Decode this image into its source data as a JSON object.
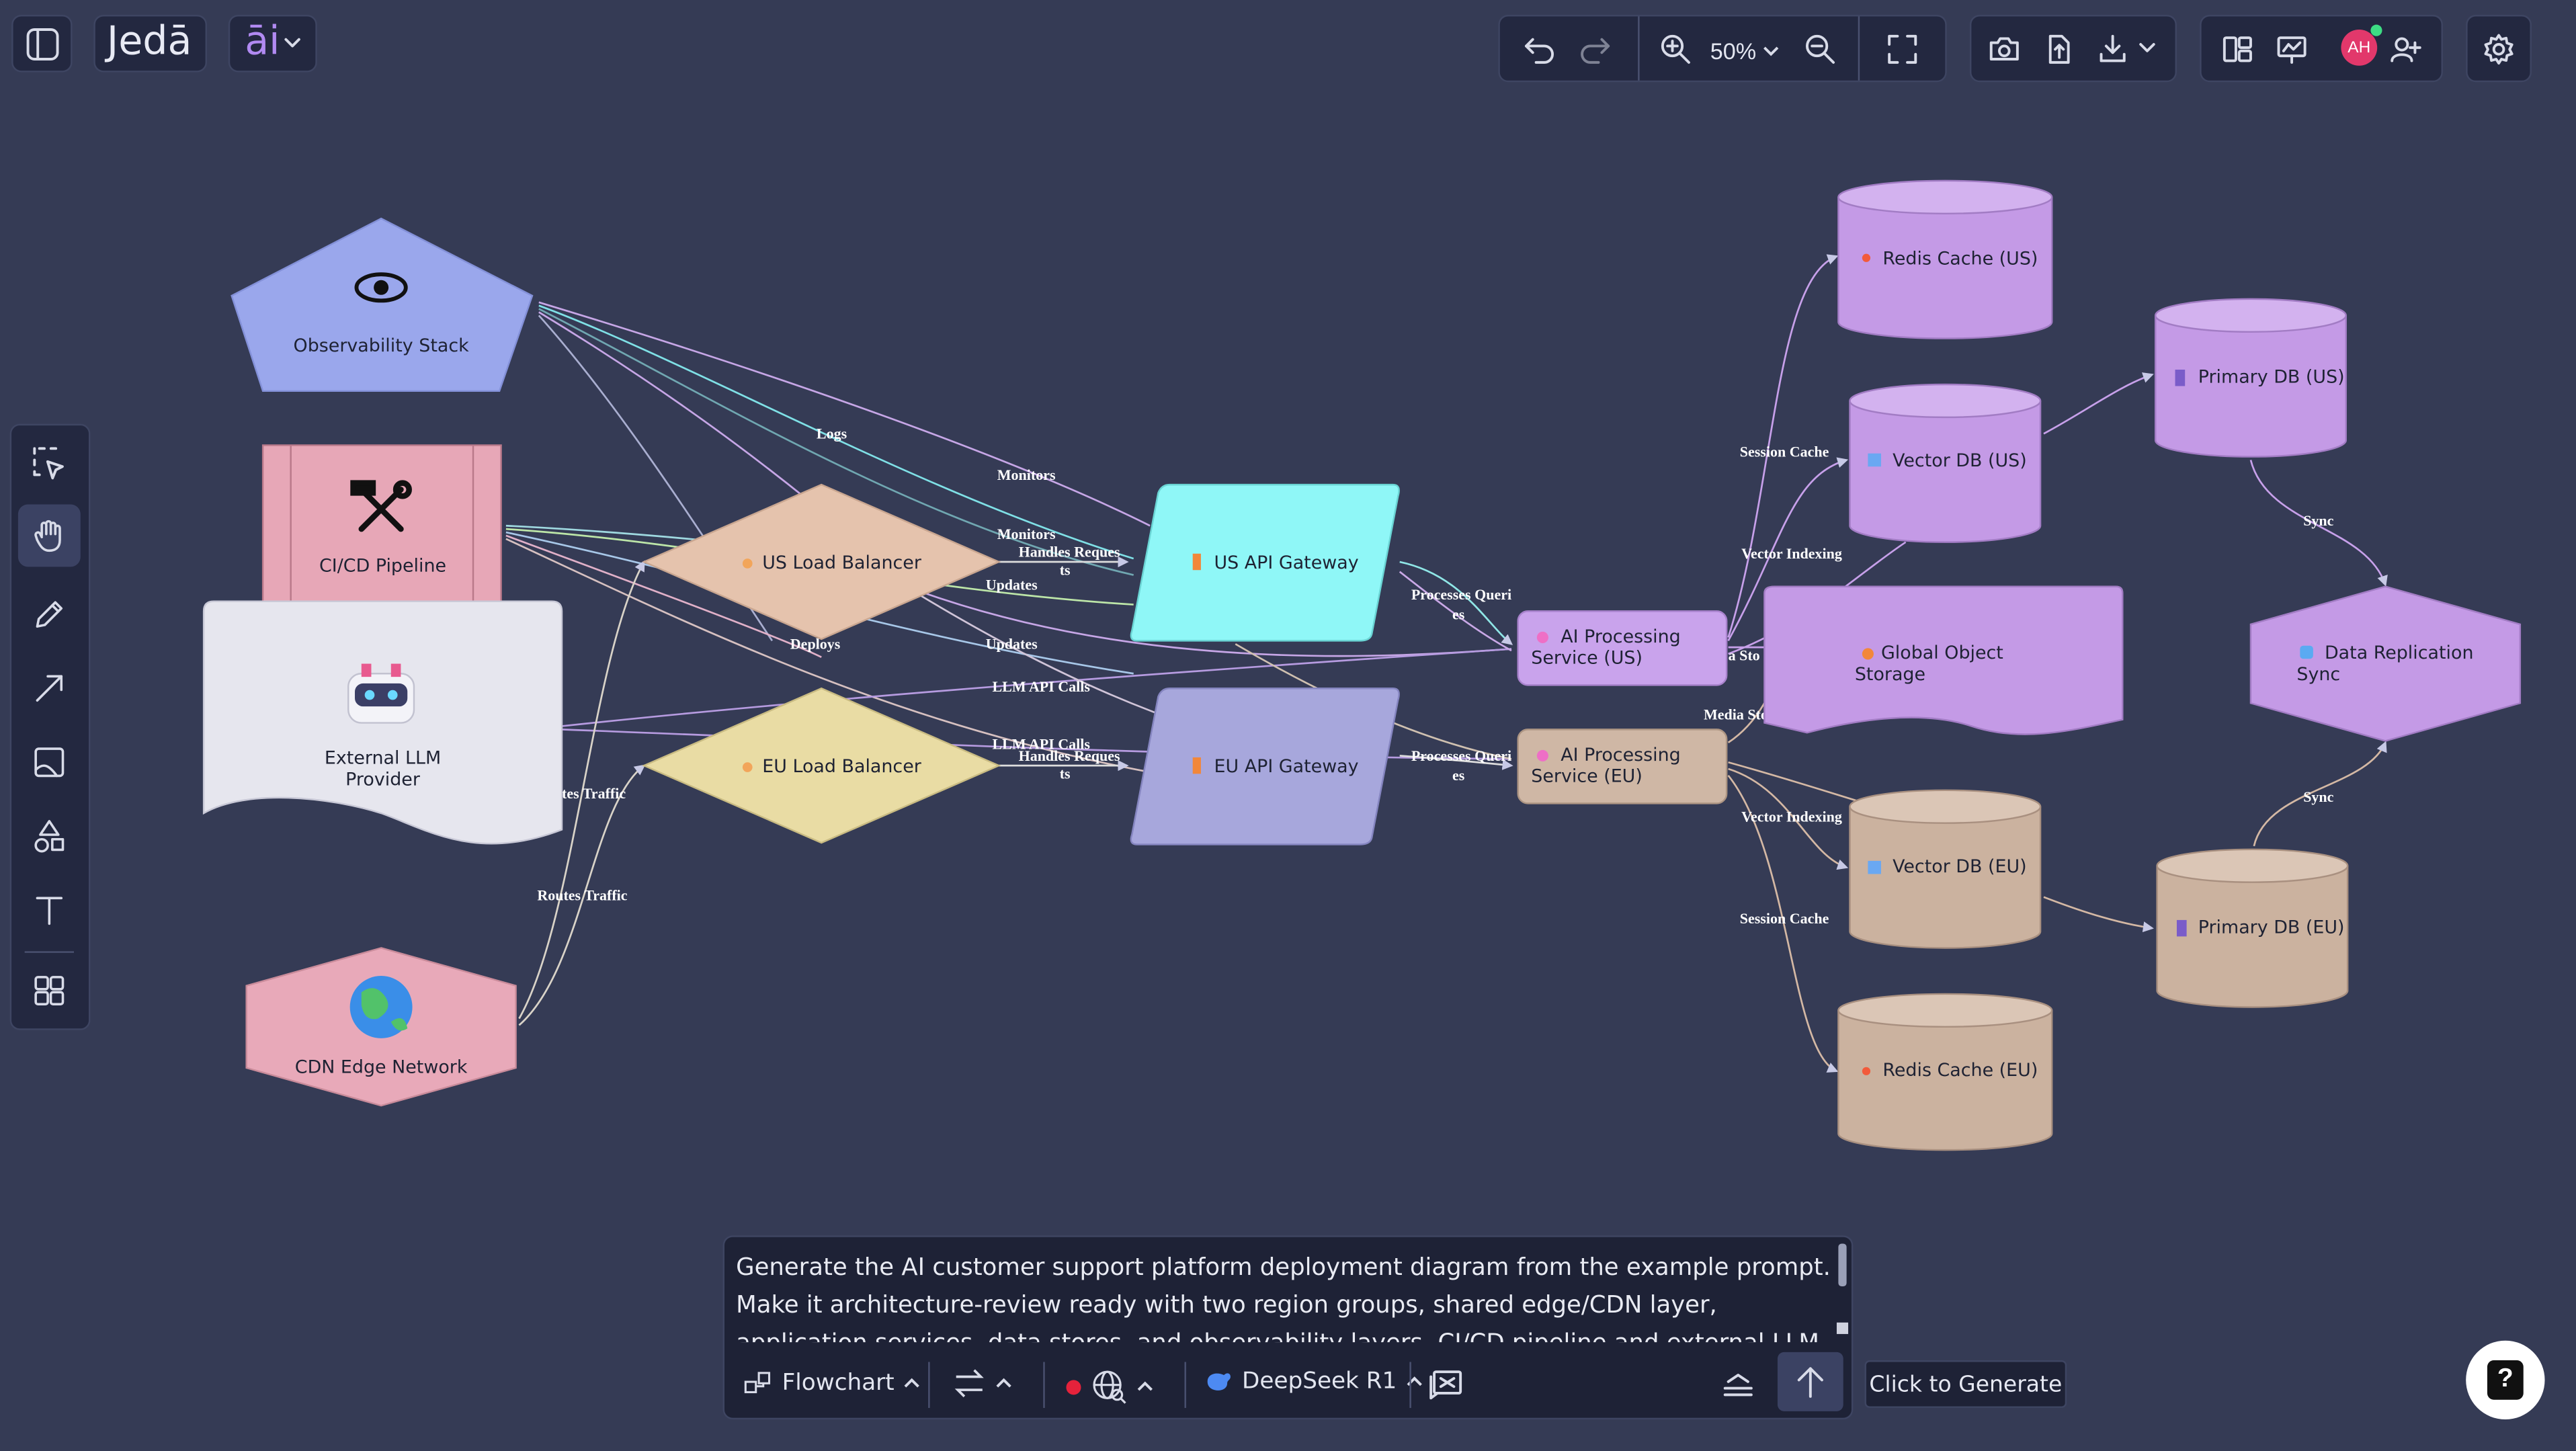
{
  "app": {
    "brand": "Jedā",
    "ai_label": "āi"
  },
  "toolbar": {
    "zoom": "50%"
  },
  "user": {
    "initials": "AH"
  },
  "diagram": {
    "nodes": {
      "observability": "Observability Stack",
      "cicd": "CI/CD Pipeline",
      "external_llm": "External LLM Provider",
      "cdn": "CDN Edge Network",
      "us_lb": "US Load Balancer",
      "eu_lb": "EU Load Balancer",
      "us_gw": "US API Gateway",
      "eu_gw": "EU API Gateway",
      "ai_us": "AI Processing Service (US)",
      "ai_eu": "AI Processing Service (EU)",
      "global_storage": "Global Object Storage",
      "redis_us": "Redis Cache (US)",
      "vector_us": "Vector DB (US)",
      "primary_us": "Primary DB (US)",
      "replication": "Data Replication Sync",
      "vector_eu": "Vector DB (EU)",
      "primary_eu": "Primary DB (EU)",
      "redis_eu": "Redis Cache (EU)"
    },
    "edges": {
      "logs": "Logs",
      "monitors1": "Monitors",
      "monitors2": "Monitors",
      "handles_us_a": "Handles Reques",
      "handles_us_b": "ts",
      "updates1": "Updates",
      "updates2": "Updates",
      "deploys": "Deploys",
      "llm1": "LLM API Calls",
      "llm2": "LLM API Calls",
      "handles_eu_a": "Handles Reques",
      "handles_eu_b": "ts",
      "routes1": "tes Traffic",
      "routes2": "Routes Traffic",
      "pq_us_a": "Processes Queri",
      "pq_us_b": "es",
      "pq_eu_a": "Processes Queri",
      "pq_eu_b": "es",
      "session_us": "Session Cache",
      "vector_idx_us": "Vector Indexing",
      "media_us": "a Sto",
      "media_eu": "Media Storage",
      "vector_idx_eu": "Vector Indexing",
      "session_eu": "Session Cache",
      "sync1": "Sync",
      "sync2": "Sync"
    }
  },
  "prompt": {
    "text": "Generate the AI customer support platform deployment diagram from the example prompt. Make it architecture-review ready with two region groups, shared edge/CDN layer, application services, data stores, and observability layers. CI/CD pipeline and external LLM provider. Use clean",
    "diagram_type": "Flowchart",
    "model": "DeepSeek R1",
    "generate_tooltip": "Click to Generate"
  },
  "colors": {
    "canvas": "#353b55",
    "accent_purple": "#c7a0ea",
    "us_tan": "#e5c3ad",
    "eu_yellow": "#e9dca4",
    "gateway_cyan": "#8ff7f7",
    "gateway_violet": "#a7a7dc",
    "us_db_purple": "#c49ae6",
    "eu_db_tan": "#cbb29f",
    "pink": "#e8a9b9"
  }
}
